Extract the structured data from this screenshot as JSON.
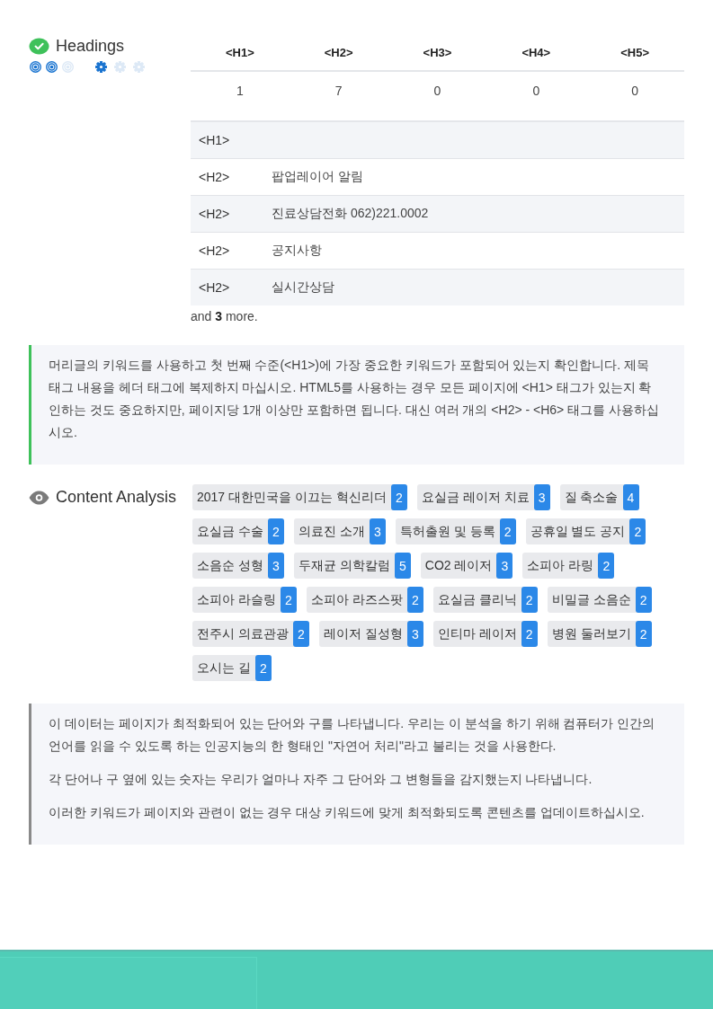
{
  "headings": {
    "title": "Headings",
    "importance": [
      {
        "on": true
      },
      {
        "on": true
      },
      {
        "on": false
      }
    ],
    "difficulty": [
      {
        "on": true
      },
      {
        "on": false
      },
      {
        "on": false
      }
    ],
    "counts": {
      "columns": [
        "<H1>",
        "<H2>",
        "<H3>",
        "<H4>",
        "<H5>"
      ],
      "values": [
        "1",
        "7",
        "0",
        "0",
        "0"
      ]
    },
    "list": [
      {
        "tag": "<H1>"
      },
      {
        "tag": "<H2>",
        "text": "팝업레이어 알림"
      },
      {
        "tag": "<H2>",
        "text": "진료상담전화 062)221.0002"
      },
      {
        "tag": "<H2>",
        "text": "공지사항"
      },
      {
        "tag": "<H2>",
        "text": "실시간상담"
      }
    ],
    "more": "and **3** more.",
    "tip": "머리글의 키워드를 사용하고 첫 번째 수준(<H1>)에 가장 중요한 키워드가 포함되어 있는지 확인합니다. 제목 태그 내용을 헤더 태그에 복제하지 마십시오. HTML5를 사용하는 경우 모든 페이지에 <H1> 태그가 있는지 확인하는 것도 중요하지만, 페이지당 1개 이상만 포함하면 됩니다. 대신 여러 개의 <H2> - <H6> 태그를 사용하십시오."
  },
  "content_analysis": {
    "title": "Content Analysis",
    "keywords": [
      {
        "text": "2017 대한민국을 이끄는 혁신리더",
        "count": "2"
      },
      {
        "text": "요실금 레이저 치료",
        "count": "3"
      },
      {
        "text": "질 축소술",
        "count": "4"
      },
      {
        "text": "요실금 수술",
        "count": "2"
      },
      {
        "text": "의료진 소개",
        "count": "3"
      },
      {
        "text": "특허출원 및 등록",
        "count": "2"
      },
      {
        "text": "공휴일 별도 공지",
        "count": "2"
      },
      {
        "text": "소음순 성형",
        "count": "3"
      },
      {
        "text": "두재균 의학칼럼",
        "count": "5"
      },
      {
        "text": "CO2 레이저",
        "count": "3"
      },
      {
        "text": "소피아 라링",
        "count": "2"
      },
      {
        "text": "소피아 라슬링",
        "count": "2"
      },
      {
        "text": "소피아 라즈스팟",
        "count": "2"
      },
      {
        "text": "요실금 클리닉",
        "count": "2"
      },
      {
        "text": "비밀글 소음순",
        "count": "2"
      },
      {
        "text": "전주시 의료관광",
        "count": "2"
      },
      {
        "text": "레이저 질성형",
        "count": "3"
      },
      {
        "text": "인티마 레이저",
        "count": "2"
      },
      {
        "text": "병원 둘러보기",
        "count": "2"
      },
      {
        "text": "오시는 길",
        "count": "2"
      }
    ],
    "notes": [
      "이 데이터는 페이지가 최적화되어 있는 단어와 구를 나타냅니다. 우리는 이 분석을 하기 위해 컴퓨터가 인간의 언어를 읽을 수 있도록 하는 인공지능의 한 형태인 \"자연어 처리\"라고 불리는 것을 사용한다.",
      "각 단어나 구 옆에 있는 숫자는 우리가 얼마나 자주 그 단어와 그 변형들을 감지했는지 나타냅니다.",
      "이러한 키워드가 페이지와 관련이 없는 경우 대상 키워드에 맞게 최적화되도록 콘텐츠를 업데이트하십시오."
    ]
  }
}
